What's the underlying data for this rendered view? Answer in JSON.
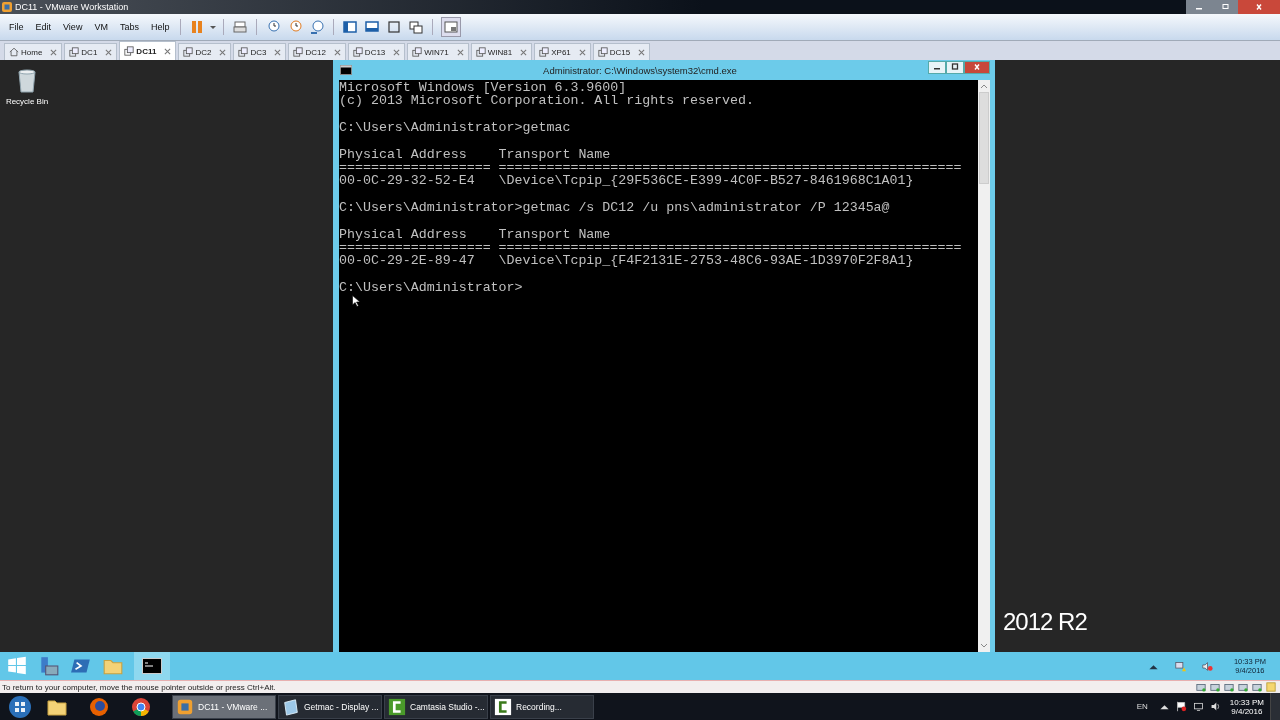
{
  "window": {
    "title": "DC11 - VMware Workstation"
  },
  "menu": [
    "File",
    "Edit",
    "View",
    "VM",
    "Tabs",
    "Help"
  ],
  "tabs": [
    {
      "label": "Home",
      "kind": "home",
      "selected": false
    },
    {
      "label": "DC1",
      "kind": "vm",
      "selected": false
    },
    {
      "label": "DC11",
      "kind": "vm",
      "selected": true
    },
    {
      "label": "DC2",
      "kind": "vm",
      "selected": false
    },
    {
      "label": "DC3",
      "kind": "vm",
      "selected": false
    },
    {
      "label": "DC12",
      "kind": "vm",
      "selected": false
    },
    {
      "label": "DC13",
      "kind": "vm",
      "selected": false
    },
    {
      "label": "WIN71",
      "kind": "vm",
      "selected": false
    },
    {
      "label": "WIN81",
      "kind": "vm",
      "selected": false
    },
    {
      "label": "XP61",
      "kind": "vm",
      "selected": false
    },
    {
      "label": "DC15",
      "kind": "vm",
      "selected": false
    }
  ],
  "guest_desktop": {
    "icons": [
      {
        "label": "Recycle Bin"
      }
    ],
    "branding": "2012 R2"
  },
  "cmd_window": {
    "title": "Administrator: C:\\Windows\\system32\\cmd.exe",
    "blocks": [
      [
        "Microsoft Windows [Version 6.3.9600]",
        "(c) 2013 Microsoft Corporation. All rights reserved."
      ],
      [
        "C:\\Users\\Administrator>getmac"
      ],
      [
        "Physical Address    Transport Name",
        "=================== ==========================================================",
        "00-0C-29-32-52-E4   \\Device\\Tcpip_{29F536CE-E399-4C0F-B527-8461968C1A01}"
      ],
      [
        "C:\\Users\\Administrator>getmac /s DC12 /u pns\\administrator /P 12345a@"
      ],
      [
        "Physical Address    Transport Name",
        "=================== ==========================================================",
        "00-0C-29-2E-89-47   \\Device\\Tcpip_{F4F2131E-2753-48C6-93AE-1D3970F2F8A1}"
      ],
      [
        "C:\\Users\\Administrator>"
      ]
    ]
  },
  "guest_taskbar": {
    "clock": {
      "time": "10:33 PM",
      "date": "9/4/2016"
    }
  },
  "status_bar": "To return to your computer, move the mouse pointer outside or press Ctrl+Alt.",
  "host_taskbar": {
    "buttons": [
      {
        "label": "DC11 - VMware ...",
        "kind": "vmware",
        "selected": true
      },
      {
        "label": "Getmac - Display ...",
        "kind": "doc",
        "selected": false
      },
      {
        "label": "Camtasia Studio -...",
        "kind": "camtasia",
        "selected": false
      },
      {
        "label": "Recording...",
        "kind": "recorder",
        "selected": false
      }
    ],
    "language": "EN",
    "clock": {
      "time": "10:33 PM",
      "date": "9/4/2016"
    }
  }
}
